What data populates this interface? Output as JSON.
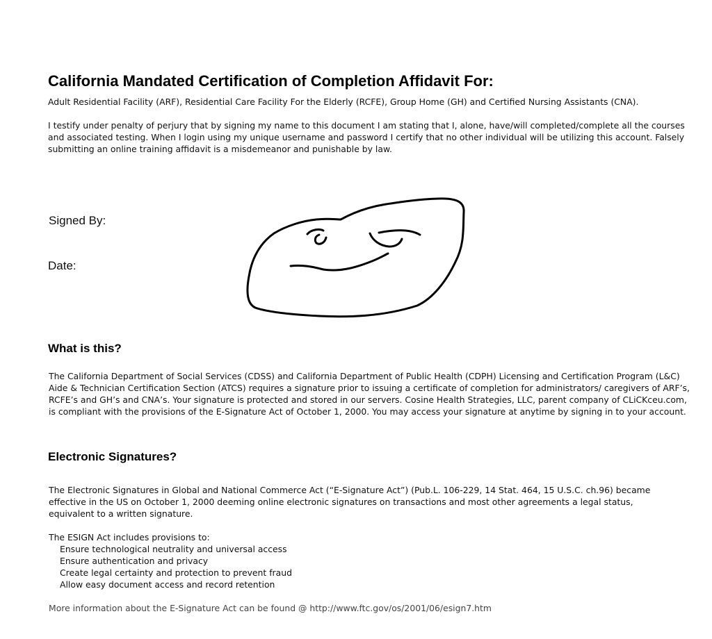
{
  "title": "California Mandated Certification of Completion Affidavit For:",
  "subtitle": "Adult Residential Facility (ARF), Residential Care Facility For the Elderly (RCFE), Group Home (GH) and Certified Nursing Assistants (CNA).",
  "attestation": "I testify under penalty of perjury that by signing my name to this document I am stating that I, alone, have/will completed/complete all the courses and associated testing. When I login using my unique username and password I certify that no other individual will be utilizing this account. Falsely submitting an online training affidavit is a misdemeanor and punishable by law.",
  "signature": {
    "signed_by_label": "Signed By:",
    "date_label": "Date:"
  },
  "what_is_this": {
    "heading": "What is this?",
    "text": "The California Department of Social Services (CDSS) and California Department of Public Health (CDPH) Licensing and Certification Program (L&C) Aide & Technician Certification Section (ATCS) requires a signature prior to issuing a certificate of completion for administrators/ caregivers of ARF’s, RCFE’s and GH’s and CNA’s. Your signature is protected and stored in our servers. Cosine Health Strategies, LLC, parent company of CLiCKceu.com, is compliant with the provisions of the E-Signature Act of October 1, 2000. You may access your signature at anytime by signing in to your account."
  },
  "electronic_signatures": {
    "heading": "Electronic Signatures?",
    "text": "The Electronic Signatures in Global and National Commerce Act (“E-Signature Act”) (Pub.L. 106-229, 14 Stat. 464, 15 U.S.C. ch.96) became effective in the US on October 1, 2000 deeming online electronic signatures on transactions and most other agreements a legal status, equivalent to a written signature.",
    "provisions_intro": "The ESIGN Act includes provisions to:",
    "provisions": [
      "Ensure technological neutrality and universal access",
      "Ensure authentication and privacy",
      "Create legal certainty and protection to prevent fraud",
      "Allow easy document access and record retention"
    ],
    "more_info": "More information about the E-Signature Act can be found @ http://www.ftc.gov/os/2001/06/esign7.htm"
  }
}
